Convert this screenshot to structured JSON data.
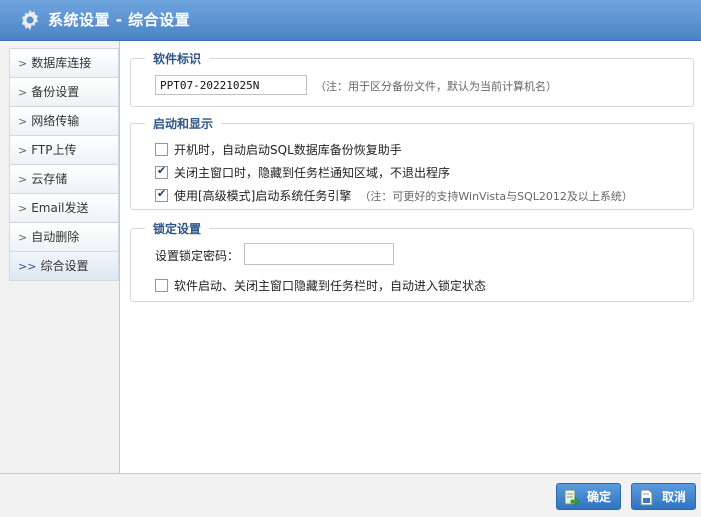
{
  "window": {
    "title": "系统设置 - 综合设置",
    "icon": "gear-icon"
  },
  "sidebar": {
    "items": [
      {
        "arrow": ">",
        "label": "数据库连接"
      },
      {
        "arrow": ">",
        "label": "备份设置"
      },
      {
        "arrow": ">",
        "label": "网络传输"
      },
      {
        "arrow": ">",
        "label": "FTP上传"
      },
      {
        "arrow": ">",
        "label": "云存储"
      },
      {
        "arrow": ">",
        "label": "Email发送"
      },
      {
        "arrow": ">",
        "label": "自动删除"
      },
      {
        "arrow": ">>",
        "label": "综合设置",
        "active": true
      }
    ]
  },
  "software_id": {
    "title": "软件标识",
    "value": "PPT07-20221025N",
    "note": "（注：用于区分备份文件，默认为当前计算机名）"
  },
  "startup": {
    "title": "启动和显示",
    "options": [
      {
        "label": "开机时，自动启动SQL数据库备份恢复助手",
        "checked": false
      },
      {
        "label": "关闭主窗口时，隐藏到任务栏通知区域，不退出程序",
        "checked": true
      },
      {
        "label": "使用[高级模式]启动系统任务引擎",
        "checked": true,
        "note": "（注：可更好的支持WinVista与SQL2012及以上系统）"
      }
    ]
  },
  "lock": {
    "title": "锁定设置",
    "password_label": "设置锁定密码：",
    "password_value": "",
    "auto_lock_label": "软件启动、关闭主窗口隐藏到任务栏时，自动进入锁定状态",
    "auto_lock_checked": false
  },
  "footer": {
    "ok_label": "确定",
    "cancel_label": "取消"
  },
  "colors": {
    "titlebar": "#5a92d2",
    "button": "#3a7fcb",
    "group_title": "#2d5684"
  }
}
